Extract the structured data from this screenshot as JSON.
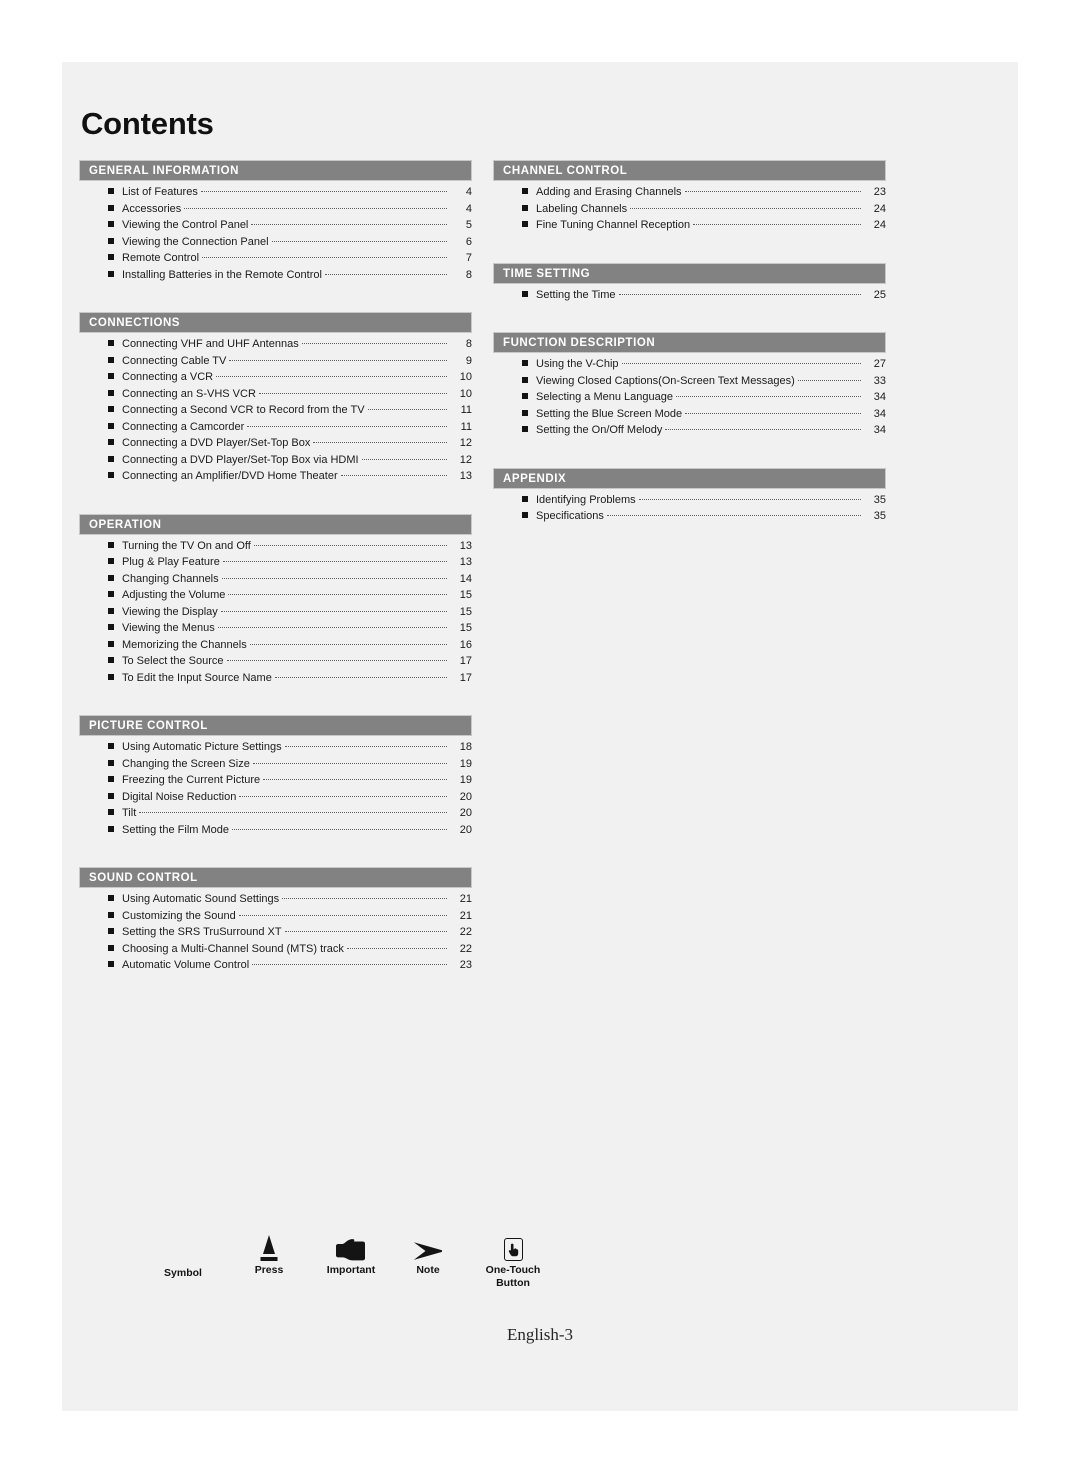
{
  "page": {
    "title": "Contents",
    "footer": "English-3"
  },
  "columns": {
    "left": [
      {
        "header": "GENERAL INFORMATION",
        "entries": [
          {
            "title": "List of Features",
            "page": "4"
          },
          {
            "title": "Accessories",
            "page": "4"
          },
          {
            "title": "Viewing the Control Panel",
            "page": "5"
          },
          {
            "title": "Viewing the Connection Panel",
            "page": "6"
          },
          {
            "title": "Remote Control",
            "page": "7"
          },
          {
            "title": "Installing Batteries in the Remote Control",
            "page": "8"
          }
        ]
      },
      {
        "header": "CONNECTIONS",
        "entries": [
          {
            "title": "Connecting VHF and UHF Antennas",
            "page": "8"
          },
          {
            "title": "Connecting Cable TV",
            "page": "9"
          },
          {
            "title": "Connecting a VCR",
            "page": "10"
          },
          {
            "title": "Connecting an S-VHS VCR",
            "page": "10"
          },
          {
            "title": "Connecting a Second VCR to Record from the TV",
            "page": "11"
          },
          {
            "title": "Connecting a Camcorder",
            "page": "11"
          },
          {
            "title": "Connecting a DVD Player/Set-Top Box",
            "page": "12"
          },
          {
            "title": "Connecting a DVD Player/Set-Top Box via HDMI",
            "page": "12"
          },
          {
            "title": "Connecting an Amplifier/DVD Home Theater",
            "page": "13"
          }
        ]
      },
      {
        "header": "OPERATION",
        "entries": [
          {
            "title": "Turning the TV On and Off",
            "page": "13"
          },
          {
            "title": "Plug & Play Feature",
            "page": "13"
          },
          {
            "title": "Changing Channels",
            "page": "14"
          },
          {
            "title": "Adjusting the Volume",
            "page": "15"
          },
          {
            "title": "Viewing the Display",
            "page": "15"
          },
          {
            "title": "Viewing the Menus",
            "page": "15"
          },
          {
            "title": "Memorizing the Channels",
            "page": "16"
          },
          {
            "title": "To Select the Source",
            "page": "17"
          },
          {
            "title": "To Edit the Input Source Name",
            "page": "17"
          }
        ]
      },
      {
        "header": "PICTURE CONTROL",
        "entries": [
          {
            "title": "Using Automatic Picture Settings",
            "page": "18"
          },
          {
            "title": "Changing the Screen Size",
            "page": "19"
          },
          {
            "title": "Freezing the Current Picture",
            "page": "19"
          },
          {
            "title": "Digital Noise Reduction",
            "page": "20"
          },
          {
            "title": "Tilt",
            "page": "20"
          },
          {
            "title": "Setting the Film Mode",
            "page": "20"
          }
        ]
      },
      {
        "header": "SOUND CONTROL",
        "entries": [
          {
            "title": "Using Automatic Sound Settings",
            "page": "21"
          },
          {
            "title": "Customizing the Sound",
            "page": "21"
          },
          {
            "title": "Setting the SRS TruSurround XT",
            "page": "22"
          },
          {
            "title": "Choosing a Multi-Channel Sound (MTS) track",
            "page": "22"
          },
          {
            "title": "Automatic Volume Control",
            "page": "23"
          }
        ]
      }
    ],
    "right": [
      {
        "header": "CHANNEL CONTROL",
        "entries": [
          {
            "title": "Adding and Erasing Channels",
            "page": "23"
          },
          {
            "title": "Labeling Channels",
            "page": "24"
          },
          {
            "title": "Fine Tuning Channel Reception",
            "page": "24"
          }
        ]
      },
      {
        "header": "TIME SETTING",
        "entries": [
          {
            "title": "Setting the Time",
            "page": "25"
          }
        ]
      },
      {
        "header": "FUNCTION DESCRIPTION",
        "entries": [
          {
            "title": "Using the V-Chip",
            "page": "27"
          },
          {
            "title": "Viewing Closed Captions(On-Screen Text Messages)",
            "page": "33"
          },
          {
            "title": "Selecting a Menu Language",
            "page": "34"
          },
          {
            "title": "Setting the Blue Screen Mode",
            "page": "34"
          },
          {
            "title": "Setting the On/Off Melody",
            "page": "34"
          }
        ]
      },
      {
        "header": "APPENDIX",
        "entries": [
          {
            "title": "Identifying Problems",
            "page": "35"
          },
          {
            "title": "Specifications",
            "page": "35"
          }
        ]
      }
    ]
  },
  "legend": {
    "symbol_label": "Symbol",
    "items": [
      {
        "icon": "press-triangle-icon",
        "label": "Press"
      },
      {
        "icon": "pointing-hand-icon",
        "label": "Important"
      },
      {
        "icon": "arrowhead-right-icon",
        "label": "Note"
      },
      {
        "icon": "one-touch-button-icon",
        "label": "One-Touch\nButton"
      }
    ]
  },
  "colors": {
    "page_background": "#f1f1f1",
    "section_header_bg": "#828282",
    "section_header_text": "#ffffff",
    "text": "#1b1b1b"
  }
}
